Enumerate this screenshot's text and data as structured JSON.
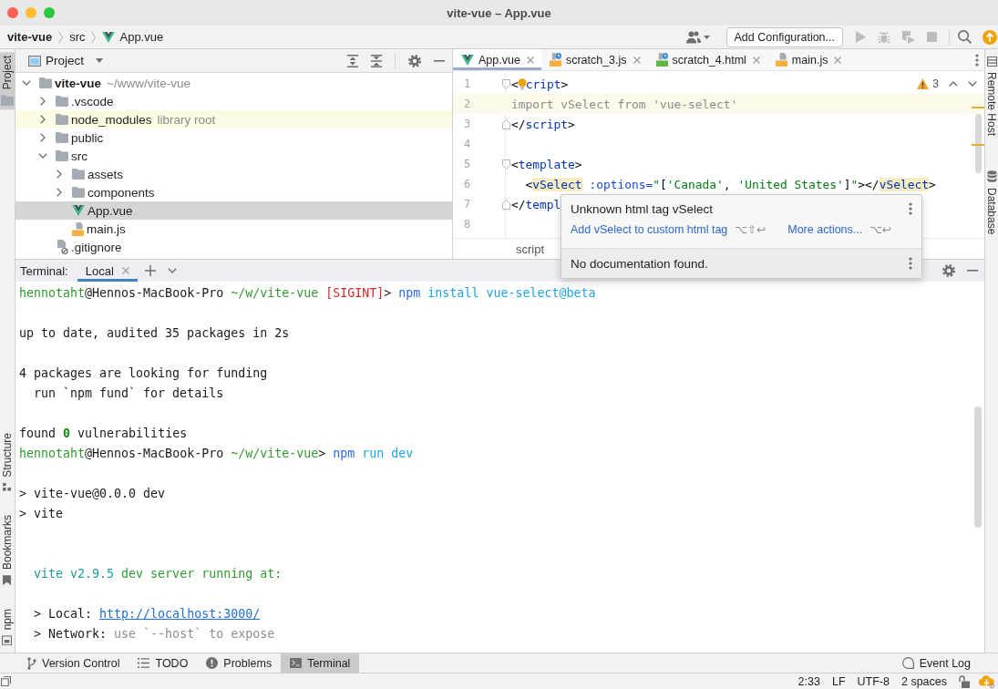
{
  "window": {
    "title": "vite-vue – App.vue"
  },
  "navigation_bar": {
    "breadcrumbs": [
      {
        "label": "vite-vue",
        "kind": "project"
      },
      {
        "label": "src",
        "kind": "folder"
      },
      {
        "label": "App.vue",
        "kind": "vue"
      }
    ],
    "run_configuration": "Add Configuration...",
    "run_tools": [
      {
        "kind": "run",
        "disabled": true
      },
      {
        "kind": "debug",
        "disabled": true
      },
      {
        "kind": "coverage",
        "disabled": true
      },
      {
        "kind": "stop",
        "disabled": true
      }
    ]
  },
  "left_stripe": {
    "top": [
      {
        "label": "Project",
        "kind": "project",
        "selected": true
      }
    ],
    "bottom": [
      {
        "label": "Structure",
        "kind": "structure",
        "selected": false
      },
      {
        "label": "Bookmarks",
        "kind": "bookmarks",
        "selected": false
      },
      {
        "label": "npm",
        "kind": "npm",
        "selected": false
      }
    ]
  },
  "right_stripe": [
    {
      "label": "Remote Host",
      "kind": "remote_host",
      "selected": false
    },
    {
      "label": "Database",
      "kind": "database",
      "selected": false
    }
  ],
  "project": {
    "title": "Project",
    "tree": [
      {
        "name": "vite-vue",
        "hint": "~/www/vite-vue",
        "kind": "project",
        "expanded": true,
        "selected": false,
        "highlighted": false,
        "children": [
          {
            "name": ".vscode",
            "kind": "folder",
            "expanded": false,
            "selected": false,
            "highlighted": false
          },
          {
            "name": "node_modules",
            "hint": "library root",
            "kind": "folder",
            "expanded": false,
            "selected": false,
            "highlighted": true
          },
          {
            "name": "public",
            "kind": "folder",
            "expanded": false,
            "selected": false,
            "highlighted": false
          },
          {
            "name": "src",
            "kind": "folder",
            "expanded": true,
            "selected": false,
            "highlighted": false,
            "children": [
              {
                "name": "assets",
                "kind": "folder",
                "expanded": false,
                "selected": false,
                "highlighted": false
              },
              {
                "name": "components",
                "kind": "folder",
                "expanded": false,
                "selected": false,
                "highlighted": false
              },
              {
                "name": "App.vue",
                "kind": "vue",
                "selected": true,
                "highlighted": false
              },
              {
                "name": "main.js",
                "kind": "js",
                "selected": false,
                "highlighted": false
              }
            ]
          },
          {
            "name": ".gitignore",
            "kind": "gitignore",
            "selected": false,
            "highlighted": false
          }
        ]
      }
    ]
  },
  "editor": {
    "tabs": [
      {
        "label": "App.vue",
        "kind": "vue",
        "scratch": false,
        "selected": true
      },
      {
        "label": "scratch_3.js",
        "kind": "js",
        "scratch": true,
        "selected": false
      },
      {
        "label": "scratch_4.html",
        "kind": "html",
        "scratch": true,
        "selected": false
      },
      {
        "label": "main.js",
        "kind": "js",
        "scratch": false,
        "selected": false
      }
    ],
    "inspection_count": "3",
    "lines": [
      {
        "number": "1",
        "fold_start": true,
        "fold_end": false,
        "current": false,
        "tokens": [
          {
            "kind": "punct",
            "text": "<"
          },
          {
            "kind": "bulb"
          },
          {
            "kind": "tag",
            "text": "cript"
          },
          {
            "kind": "punct",
            "text": ">"
          }
        ]
      },
      {
        "number": "2",
        "fold_start": false,
        "fold_end": false,
        "current": true,
        "tokens": [
          {
            "kind": "unused",
            "text": "import vSelect from 'vue-select'"
          }
        ]
      },
      {
        "number": "3",
        "fold_start": false,
        "fold_end": true,
        "current": false,
        "tokens": [
          {
            "kind": "punct",
            "text": "</"
          },
          {
            "kind": "tag",
            "text": "script"
          },
          {
            "kind": "punct",
            "text": ">"
          }
        ]
      },
      {
        "number": "4",
        "fold_start": false,
        "fold_end": false,
        "current": false
      },
      {
        "number": "5",
        "fold_start": true,
        "fold_end": false,
        "current": false,
        "tokens": [
          {
            "kind": "punct",
            "text": "<"
          },
          {
            "kind": "tag",
            "text": "template"
          },
          {
            "kind": "punct",
            "text": ">"
          }
        ]
      },
      {
        "number": "6",
        "fold_start": false,
        "fold_end": false,
        "current": false,
        "tokens": [
          {
            "kind": "punct",
            "text": "  <"
          },
          {
            "kind": "unknown_tag",
            "text": "vSelect"
          },
          {
            "kind": "attr",
            "text": " :options="
          },
          {
            "kind": "string",
            "text": "\""
          },
          {
            "kind": "punct",
            "text": "["
          },
          {
            "kind": "string",
            "text": "'Canada'"
          },
          {
            "kind": "punct",
            "text": ", "
          },
          {
            "kind": "string",
            "text": "'United States'"
          },
          {
            "kind": "punct",
            "text": "]"
          },
          {
            "kind": "string",
            "text": "\""
          },
          {
            "kind": "punct",
            "text": "></"
          },
          {
            "kind": "unknown_tag",
            "text": "vSelect"
          },
          {
            "kind": "punct",
            "text": ">"
          }
        ]
      },
      {
        "number": "7",
        "fold_start": false,
        "fold_end": true,
        "current": false,
        "tokens": [
          {
            "kind": "punct",
            "text": "</"
          },
          {
            "kind": "tag",
            "text": "templ"
          }
        ]
      },
      {
        "number": "8",
        "fold_start": false,
        "fold_end": false,
        "current": false
      }
    ],
    "breadcrumb": "script"
  },
  "popup": {
    "title": "Unknown html tag vSelect",
    "actions": [
      {
        "label": "Add vSelect to custom html tag",
        "shortcut": "⌥⇧↩"
      },
      {
        "label": "More actions...",
        "shortcut": "⌥↩"
      }
    ],
    "documentation": "No documentation found."
  },
  "terminal": {
    "label": "Terminal:",
    "tabs": [
      {
        "label": "Local",
        "selected": true
      }
    ],
    "lines": [
      {
        "kind": "text",
        "segments": [
          {
            "kind": "user",
            "text": "hennotaht"
          },
          {
            "kind": "plain",
            "text": "@Hennos-MacBook-Pro "
          },
          {
            "kind": "path",
            "text": "~/w/vite-vue "
          },
          {
            "kind": "signal",
            "text": "[SIGINT]"
          },
          {
            "kind": "plain",
            "text": "> "
          },
          {
            "kind": "command",
            "text": "npm"
          },
          {
            "kind": "arg",
            "text": " install vue-select@beta"
          }
        ]
      },
      {
        "kind": "blank"
      },
      {
        "kind": "text",
        "segments": [
          {
            "kind": "plain",
            "text": "up to date, audited 35 packages in 2s"
          }
        ]
      },
      {
        "kind": "blank"
      },
      {
        "kind": "text",
        "segments": [
          {
            "kind": "plain",
            "text": "4 packages are looking for funding"
          }
        ]
      },
      {
        "kind": "text",
        "segments": [
          {
            "kind": "plain",
            "text": "  run `npm fund` for details"
          }
        ]
      },
      {
        "kind": "blank"
      },
      {
        "kind": "text",
        "segments": [
          {
            "kind": "plain",
            "text": "found "
          },
          {
            "kind": "number",
            "text": "0"
          },
          {
            "kind": "plain",
            "text": " vulnerabilities"
          }
        ]
      },
      {
        "kind": "text",
        "segments": [
          {
            "kind": "user",
            "text": "hennotaht"
          },
          {
            "kind": "plain",
            "text": "@Hennos-MacBook-Pro "
          },
          {
            "kind": "path",
            "text": "~/w/vite-vue"
          },
          {
            "kind": "plain",
            "text": "> "
          },
          {
            "kind": "command",
            "text": "npm"
          },
          {
            "kind": "arg",
            "text": " run dev"
          }
        ]
      },
      {
        "kind": "blank"
      },
      {
        "kind": "text",
        "segments": [
          {
            "kind": "plain",
            "text": "> vite-vue@0.0.0 dev"
          }
        ]
      },
      {
        "kind": "text",
        "segments": [
          {
            "kind": "plain",
            "text": "> vite"
          }
        ]
      },
      {
        "kind": "blank"
      },
      {
        "kind": "blank"
      },
      {
        "kind": "text",
        "segments": [
          {
            "kind": "version",
            "text": "  vite v2.9.5"
          },
          {
            "kind": "success",
            "text": " dev server running at:"
          }
        ]
      },
      {
        "kind": "blank"
      },
      {
        "kind": "text",
        "segments": [
          {
            "kind": "plain",
            "text": "  > Local: "
          },
          {
            "kind": "link",
            "text": "http://localhost:3000/"
          }
        ]
      },
      {
        "kind": "text",
        "segments": [
          {
            "kind": "plain",
            "text": "  > Network: "
          },
          {
            "kind": "muted",
            "text": "use `--host` to expose"
          }
        ]
      }
    ]
  },
  "tool_bar": {
    "left": [
      {
        "label": "Version Control",
        "kind": "version_control",
        "selected": false
      },
      {
        "label": "TODO",
        "kind": "todo",
        "selected": false
      },
      {
        "label": "Problems",
        "kind": "problems",
        "selected": false
      },
      {
        "label": "Terminal",
        "kind": "terminal",
        "selected": true
      }
    ],
    "right": [
      {
        "label": "Event Log",
        "kind": "event_log",
        "selected": false
      }
    ]
  },
  "status_bar": {
    "items": [
      "2:33",
      "LF",
      "UTF-8",
      "2 spaces"
    ]
  }
}
